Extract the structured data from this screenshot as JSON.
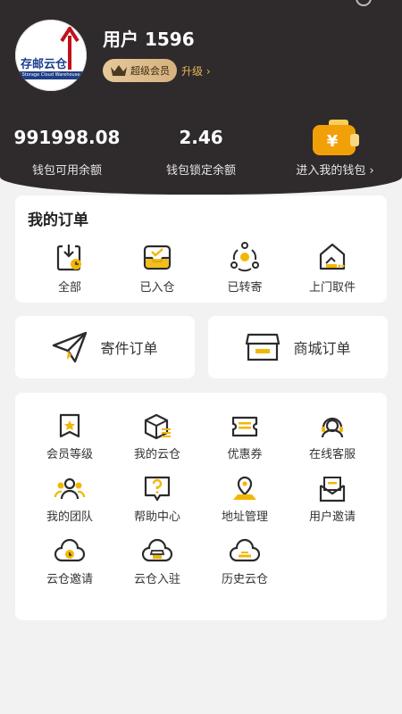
{
  "profile": {
    "avatar_logo_text": "存邮云仓",
    "avatar_logo_sub": "Storage Cloud Warehouse",
    "username": "用户 1596",
    "vip_label": "超级会员",
    "upgrade_label": "升级 ›"
  },
  "wallet": {
    "available_value": "991998.08",
    "available_label": "钱包可用余额",
    "locked_value": "2.46",
    "locked_label": "钱包锁定余额",
    "enter_label": "进入我的钱包 ›",
    "wallet_icon": "wallet-yuan-icon"
  },
  "orders": {
    "title": "我的订单",
    "items": [
      {
        "label": "全部",
        "icon": "all-orders-icon"
      },
      {
        "label": "已入仓",
        "icon": "inbox-tray-icon"
      },
      {
        "label": "已转寄",
        "icon": "forward-cycle-icon"
      },
      {
        "label": "上门取件",
        "icon": "home-pickup-icon"
      }
    ]
  },
  "quick": {
    "send_order": "寄件订单",
    "mall_order": "商城订单"
  },
  "services": {
    "items": [
      {
        "label": "会员等级",
        "icon": "member-level-icon"
      },
      {
        "label": "我的云仓",
        "icon": "cloud-warehouse-box-icon"
      },
      {
        "label": "优惠券",
        "icon": "coupon-icon"
      },
      {
        "label": "在线客服",
        "icon": "customer-service-icon"
      },
      {
        "label": "我的团队",
        "icon": "team-icon"
      },
      {
        "label": "帮助中心",
        "icon": "help-center-icon"
      },
      {
        "label": "地址管理",
        "icon": "address-pin-icon"
      },
      {
        "label": "用户邀请",
        "icon": "invite-envelope-icon"
      },
      {
        "label": "云仓邀请",
        "icon": "cloud-invite-icon"
      },
      {
        "label": "云仓入驻",
        "icon": "cloud-shop-icon"
      },
      {
        "label": "历史云仓",
        "icon": "cloud-history-icon"
      }
    ]
  },
  "colors": {
    "header_bg": "#2f2a2b",
    "accent_gold": "#f2b705",
    "icon_dark": "#2b2b2b"
  }
}
